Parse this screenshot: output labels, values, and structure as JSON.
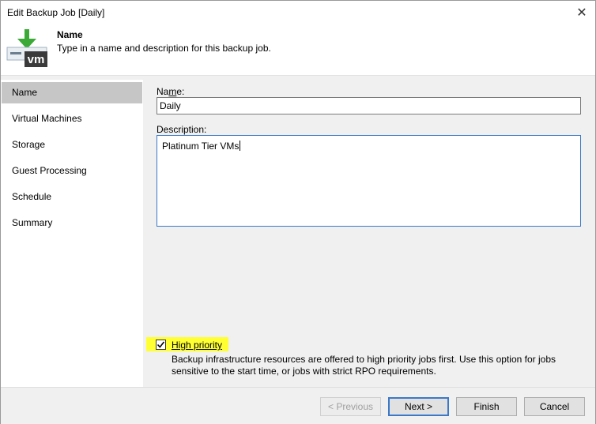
{
  "window": {
    "title": "Edit Backup Job [Daily]",
    "close_glyph": "✕"
  },
  "header": {
    "icon": "vm-backup-icon",
    "title": "Name",
    "description": "Type in a name and description for this backup job.",
    "icon_text": "vm"
  },
  "sidebar": {
    "items": [
      {
        "label": "Name",
        "active": true
      },
      {
        "label": "Virtual Machines",
        "active": false
      },
      {
        "label": "Storage",
        "active": false
      },
      {
        "label": "Guest Processing",
        "active": false
      },
      {
        "label": "Schedule",
        "active": false
      },
      {
        "label": "Summary",
        "active": false
      }
    ]
  },
  "form": {
    "name_label_prefix": "Na",
    "name_label_mnemonic": "m",
    "name_label_suffix": "e:",
    "name_value": "Daily",
    "description_label": "Description:",
    "description_value": "Platinum Tier VMs",
    "high_priority": {
      "label": "High priority",
      "checked": true,
      "description": "Backup infrastructure resources are offered to high priority jobs first. Use this option for jobs sensitive to the start time, or jobs with strict RPO requirements."
    }
  },
  "buttons": {
    "previous": "< Previous",
    "next": "Next >",
    "finish": "Finish",
    "cancel": "Cancel"
  },
  "colors": {
    "highlight": "#ffff33",
    "active_item": "#c6c6c6",
    "focus_border": "#3c78c8",
    "icon_green": "#3aa935",
    "icon_dark": "#3a3a3a"
  }
}
